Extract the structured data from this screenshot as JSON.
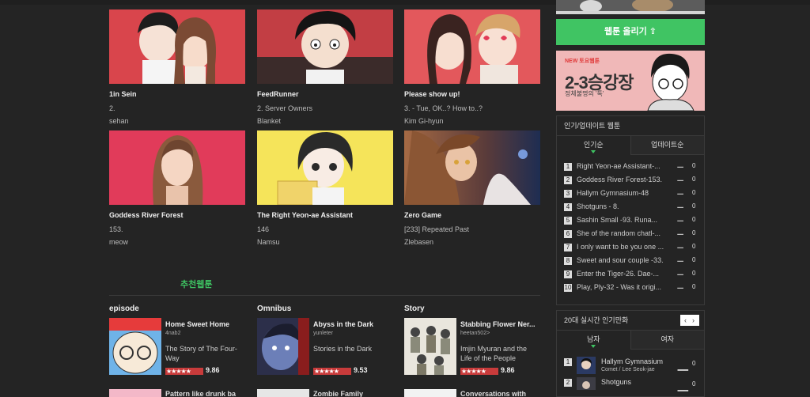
{
  "webtoons": [
    {
      "title": "1in Sein",
      "subtitle": "2.",
      "author": "sehan"
    },
    {
      "title": "FeedRunner",
      "subtitle": "2. Server Owners",
      "author": "Blanket"
    },
    {
      "title": "Please show up!",
      "subtitle": "3. - Tue, OK..? How to..?",
      "author": "Kim Gi-hyun"
    },
    {
      "title": "Goddess River Forest",
      "subtitle": "153.",
      "author": "meow"
    },
    {
      "title": "The Right Yeon-ae Assistant",
      "subtitle": "146",
      "author": "Namsu"
    },
    {
      "title": "Zero Game",
      "subtitle": "[233] Repeated Past",
      "author": "Zlebasen"
    }
  ],
  "recommend": {
    "heading_dim": "",
    "heading": "추천웹툰",
    "columns": [
      {
        "label": "episode",
        "title": "Home Sweet Home",
        "author": "4nab2",
        "desc": "The Story of The Four-Way",
        "stars": "★★★★★",
        "score": "9.86",
        "next_title": "Pattern like drunk ba"
      },
      {
        "label": "Omnibus",
        "title": "Abyss in the Dark",
        "author": "yunleter",
        "desc": "Stories in the Dark",
        "stars": "★★★★★",
        "score": "9.53",
        "next_title": "Zombie Family"
      },
      {
        "label": "Story",
        "title": "Stabbing Flower Ner...",
        "author": "heetan502>",
        "desc": "Imjin Myuran and the Life of the People",
        "stars": "★★★★★",
        "score": "9.86",
        "next_title": "Conversations with"
      }
    ]
  },
  "sidebar": {
    "upload_label": "웹툰 올리기 ⇧",
    "promo": {
      "line1": "NEW 토요웹툰",
      "line2": "2-3승강장",
      "line3": "정체불명의 '톡'"
    },
    "popular": {
      "heading": "인기/업데이트 웹툰",
      "tab_popular": "인기순",
      "tab_update": "업데이트순",
      "items": [
        {
          "rank": "1",
          "title": "Right Yeon-ae Assistant-...",
          "change": "ㅡ",
          "value": "0"
        },
        {
          "rank": "2",
          "title": "Goddess River Forest-153.",
          "change": "ㅡ",
          "value": "0"
        },
        {
          "rank": "3",
          "title": "Hallym Gymnasium-48",
          "change": "ㅡ",
          "value": "0"
        },
        {
          "rank": "4",
          "title": "Shotguns - 8.",
          "change": "ㅡ",
          "value": "0"
        },
        {
          "rank": "5",
          "title": "Sashin Small -93. Runa...",
          "change": "ㅡ",
          "value": "0"
        },
        {
          "rank": "6",
          "title": "She of the random chatl-...",
          "change": "ㅡ",
          "value": "0"
        },
        {
          "rank": "7",
          "title": "I only want to be you one ...",
          "change": "ㅡ",
          "value": "0"
        },
        {
          "rank": "8",
          "title": "Sweet and sour couple -33.",
          "change": "ㅡ",
          "value": "0"
        },
        {
          "rank": "9",
          "title": "Enter the Tiger-26. Dae-...",
          "change": "ㅡ",
          "value": "0"
        },
        {
          "rank": "10",
          "title": "Play, Ply-32 - Was it origi...",
          "change": "ㅡ",
          "value": "0"
        }
      ]
    },
    "live": {
      "heading": "20대 실시간 인기만화",
      "prev": "‹",
      "next": "›",
      "tab_male": "남자",
      "tab_female": "여자",
      "items": [
        {
          "rank": "1",
          "title": "Hallym Gymnasium",
          "author": "Comet / Lee Seok-jae",
          "change": "ㅡ",
          "value": "0"
        },
        {
          "rank": "2",
          "title": "Shotguns",
          "author": "",
          "change": "ㅡ",
          "value": "0"
        }
      ]
    }
  }
}
